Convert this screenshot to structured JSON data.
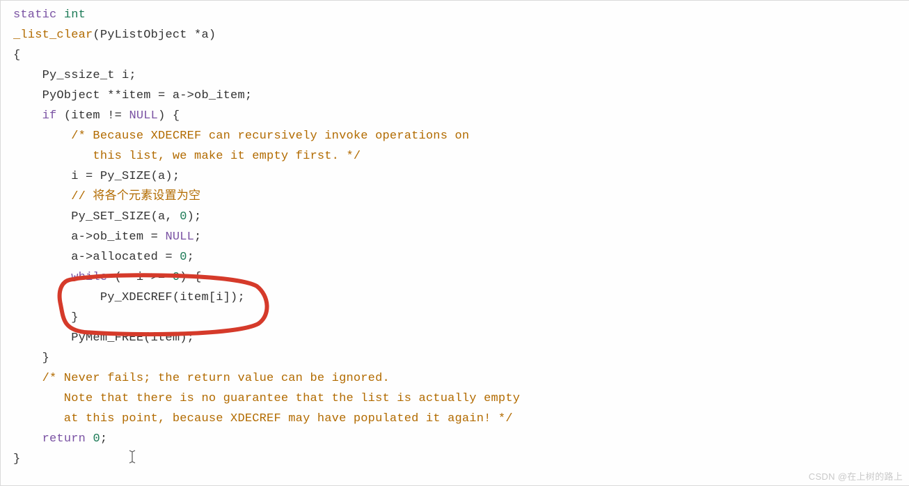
{
  "code": {
    "l1a": "static",
    "l1b": "int",
    "l2a": "_list_clear",
    "l2b": "(PyListObject *a)",
    "l3": "{",
    "l4": "    Py_ssize_t i;",
    "l5": "    PyObject **item = a->ob_item;",
    "l6a": "    ",
    "l6b": "if",
    "l6c": " (item != ",
    "l6d": "NULL",
    "l6e": ") {",
    "l7": "        /* Because XDECREF can recursively invoke operations on",
    "l8": "           this list, we make it empty first. */",
    "l9": "        i = Py_SIZE(a);",
    "l10": "        // 将各个元素设置为空",
    "l11a": "        Py_SET_SIZE(a, ",
    "l11b": "0",
    "l11c": ");",
    "l12a": "        a->ob_item = ",
    "l12b": "NULL",
    "l12c": ";",
    "l13a": "        a->allocated = ",
    "l13b": "0",
    "l13c": ";",
    "l14a": "        ",
    "l14b": "while",
    "l14c": " (--i >= ",
    "l14d": "0",
    "l14e": ") {",
    "l15": "            Py_XDECREF(item[i]);",
    "l16": "        }",
    "l17": "        PyMem_FREE(item);",
    "l18": "    }",
    "l19": "    /* Never fails; the return value can be ignored.",
    "l20": "       Note that there is no guarantee that the list is actually empty",
    "l21": "       at this point, because XDECREF may have populated it again! */",
    "l22a": "    ",
    "l22b": "return",
    "l22c": " ",
    "l22d": "0",
    "l22e": ";",
    "l23": "}"
  },
  "watermark": "CSDN @在上树的路上"
}
